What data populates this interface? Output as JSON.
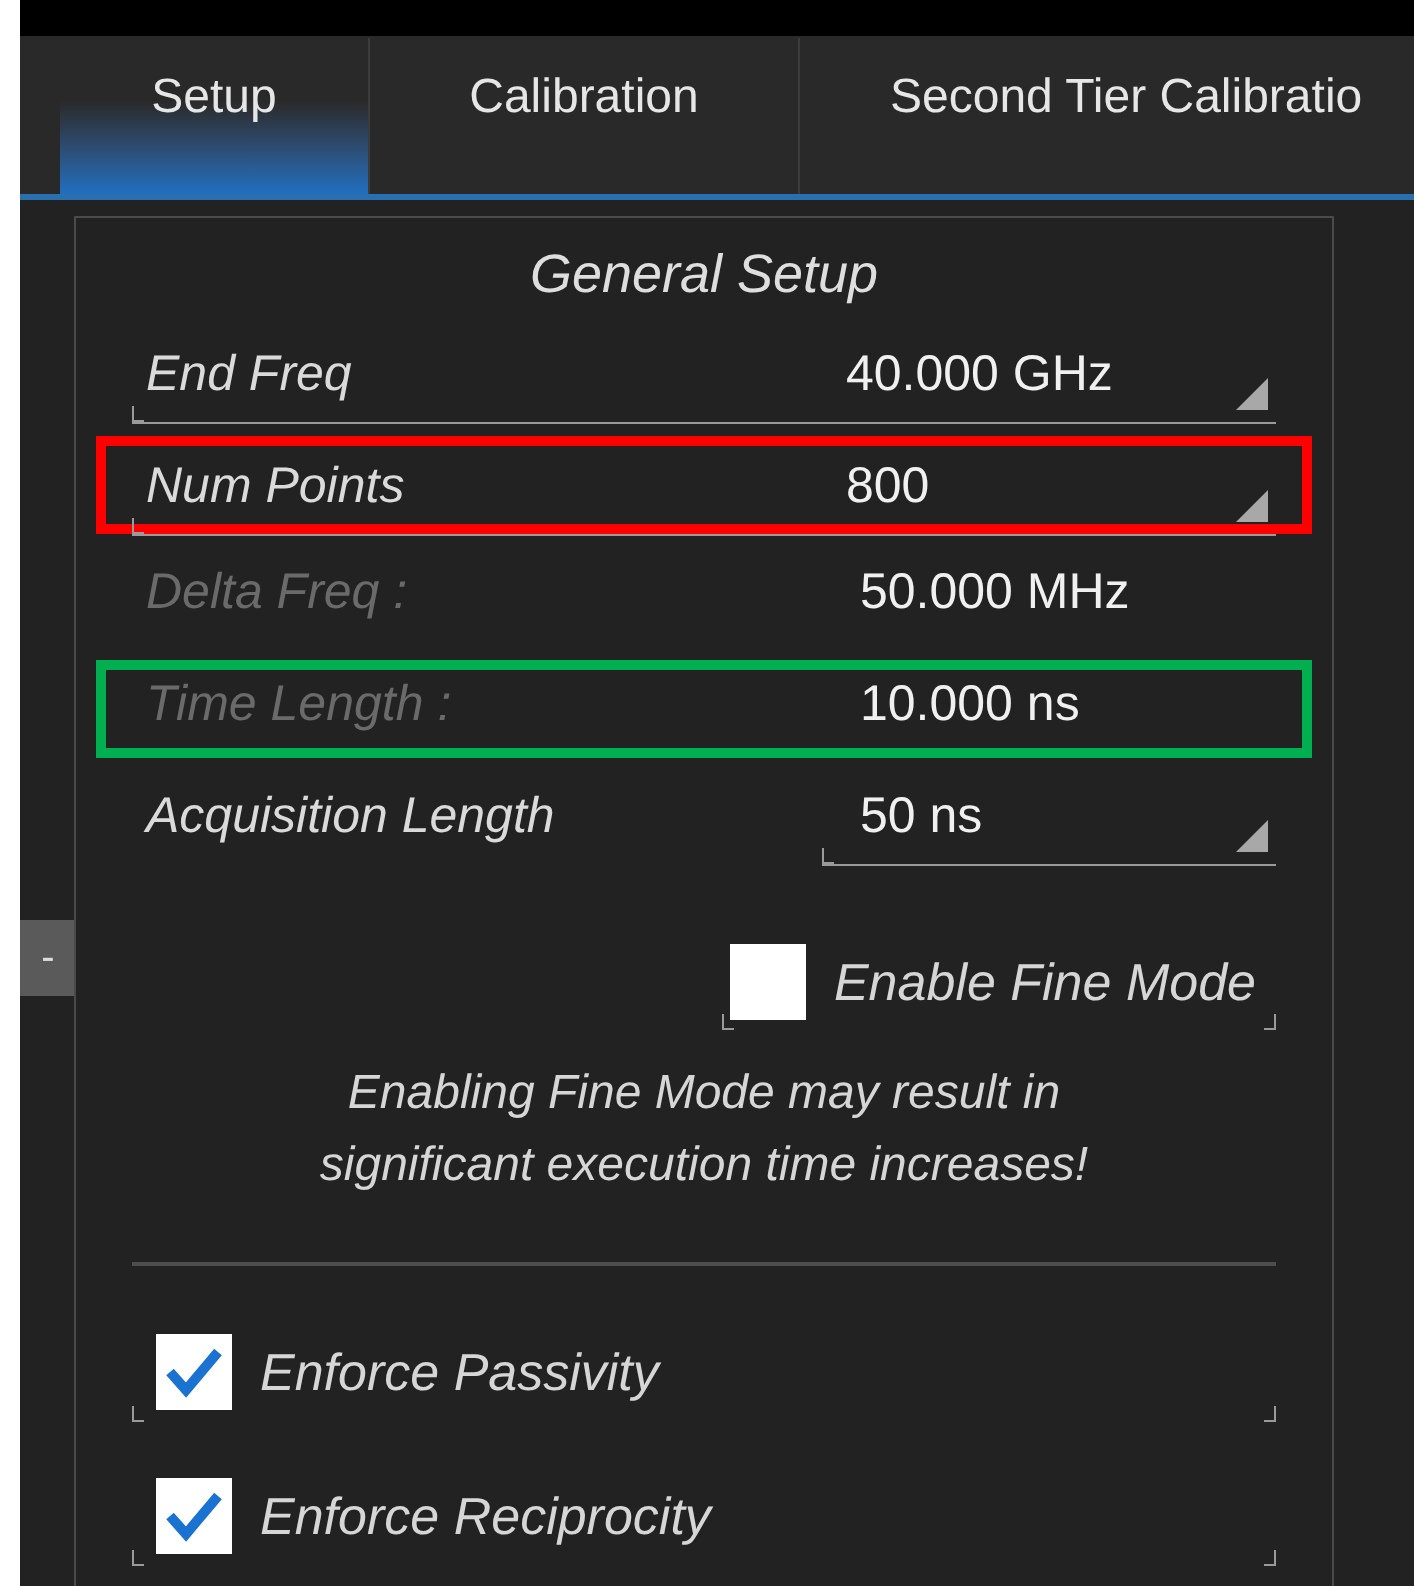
{
  "tabs": [
    {
      "label": "Setup",
      "selected": true
    },
    {
      "label": "Calibration",
      "selected": false
    },
    {
      "label": "Second Tier Calibratio",
      "selected": false
    }
  ],
  "panel": {
    "title": "General Setup",
    "rows": [
      {
        "kind": "field",
        "label": "End Freq",
        "value": "40.000 GHz",
        "disabled": false
      },
      {
        "kind": "field",
        "label": "Num Points",
        "value": "800",
        "disabled": false,
        "color": "#ff0000"
      },
      {
        "kind": "readonly",
        "label": "Delta Freq :",
        "value": "50.000 MHz",
        "disabled": true
      },
      {
        "kind": "readonly",
        "label": "Time Length :",
        "value": "10.000 ns",
        "disabled": true,
        "color": "#00b050"
      },
      {
        "kind": "value_field",
        "label": "Acquisition Length",
        "value": "50 ns",
        "disabled": false
      }
    ],
    "collapse_button": "-",
    "fine_mode": {
      "label": "Enable Fine Mode",
      "checked": false
    },
    "note": "Enabling Fine Mode may result in significant execution time increases!",
    "options": [
      {
        "label": "Enforce Passivity",
        "checked": true
      },
      {
        "label": "Enforce Reciprocity",
        "checked": true
      }
    ]
  }
}
